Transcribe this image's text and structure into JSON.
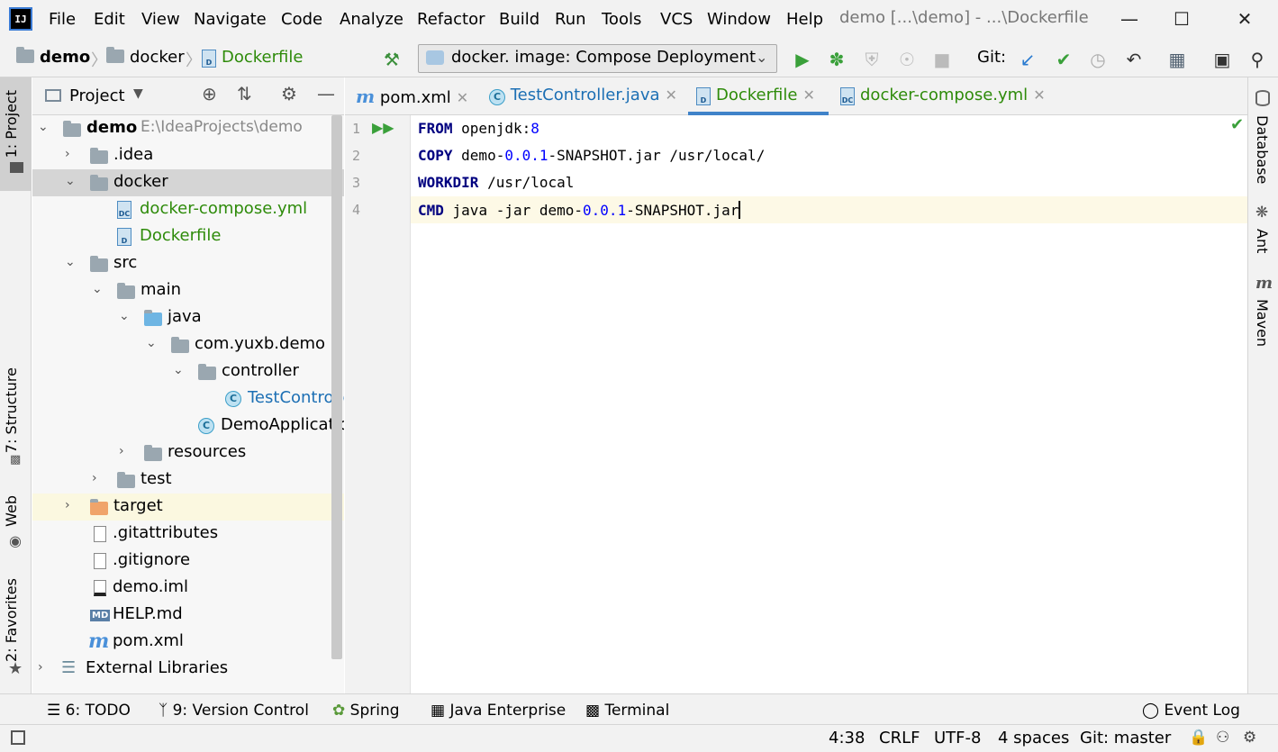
{
  "app": {
    "icon_text": "IJ",
    "window_title": "demo [...\\demo] - ...\\Dockerfile"
  },
  "menu": [
    "File",
    "Edit",
    "View",
    "Navigate",
    "Code",
    "Analyze",
    "Refactor",
    "Build",
    "Run",
    "Tools",
    "VCS",
    "Window",
    "Help"
  ],
  "breadcrumb": {
    "project": "demo",
    "folder": "docker",
    "file": "Dockerfile"
  },
  "run_config": {
    "label": "docker.  image: Compose Deployment"
  },
  "git_label": "Git:",
  "left_tools": {
    "project": "1: Project",
    "structure": "7: Structure",
    "web": "Web",
    "favorites": "2: Favorites"
  },
  "right_tools": {
    "database": "Database",
    "ant": "Ant",
    "maven": "Maven"
  },
  "project_panel": {
    "title": "Project",
    "tree": [
      {
        "label": "demo",
        "path": "E:\\IdeaProjects\\demo"
      },
      {
        "label": ".idea"
      },
      {
        "label": "docker"
      },
      {
        "label": "docker-compose.yml"
      },
      {
        "label": "Dockerfile"
      },
      {
        "label": "src"
      },
      {
        "label": "main"
      },
      {
        "label": "java"
      },
      {
        "label": "com.yuxb.demo"
      },
      {
        "label": "controller"
      },
      {
        "label": "TestController"
      },
      {
        "label": "DemoApplication"
      },
      {
        "label": "resources"
      },
      {
        "label": "test"
      },
      {
        "label": "target"
      },
      {
        "label": ".gitattributes"
      },
      {
        "label": ".gitignore"
      },
      {
        "label": "demo.iml"
      },
      {
        "label": "HELP.md"
      },
      {
        "label": "pom.xml"
      },
      {
        "label": "External Libraries"
      }
    ]
  },
  "editor_tabs": [
    {
      "label": "pom.xml"
    },
    {
      "label": "TestController.java"
    },
    {
      "label": "Dockerfile"
    },
    {
      "label": "docker-compose.yml"
    }
  ],
  "editor": {
    "line_numbers": [
      "1",
      "2",
      "3",
      "4"
    ],
    "lines": [
      {
        "kw": "FROM",
        "p1": " openjdk:",
        "n1": "8",
        "p2": ""
      },
      {
        "kw": "COPY",
        "p1": " demo-",
        "n1": "0.0.1",
        "p2": "-SNAPSHOT.jar /usr/local/"
      },
      {
        "kw": "WORKDIR",
        "p1": " /usr/local",
        "n1": "",
        "p2": ""
      },
      {
        "kw": "CMD",
        "p1": " java -jar demo-",
        "n1": "0.0.1",
        "p2": "-SNAPSHOT.jar"
      }
    ]
  },
  "bottom_tools": [
    {
      "label": "6: TODO"
    },
    {
      "label": "9: Version Control"
    },
    {
      "label": "Spring"
    },
    {
      "label": "Java Enterprise"
    },
    {
      "label": "Terminal"
    },
    {
      "label": "Event Log"
    }
  ],
  "status": {
    "position": "4:38",
    "line_sep": "CRLF",
    "encoding": "UTF-8",
    "indent": "4 spaces",
    "git_branch": "Git: master"
  },
  "colors": {
    "accent": "#4083c9",
    "keyword": "#000080",
    "number": "#0000ff",
    "file_green": "#2e8b0a",
    "file_blue": "#1c6fb4",
    "current_line": "#fdf9e6",
    "selected_row": "#d5d5d5",
    "ignored_row": "#fbf8e0"
  }
}
